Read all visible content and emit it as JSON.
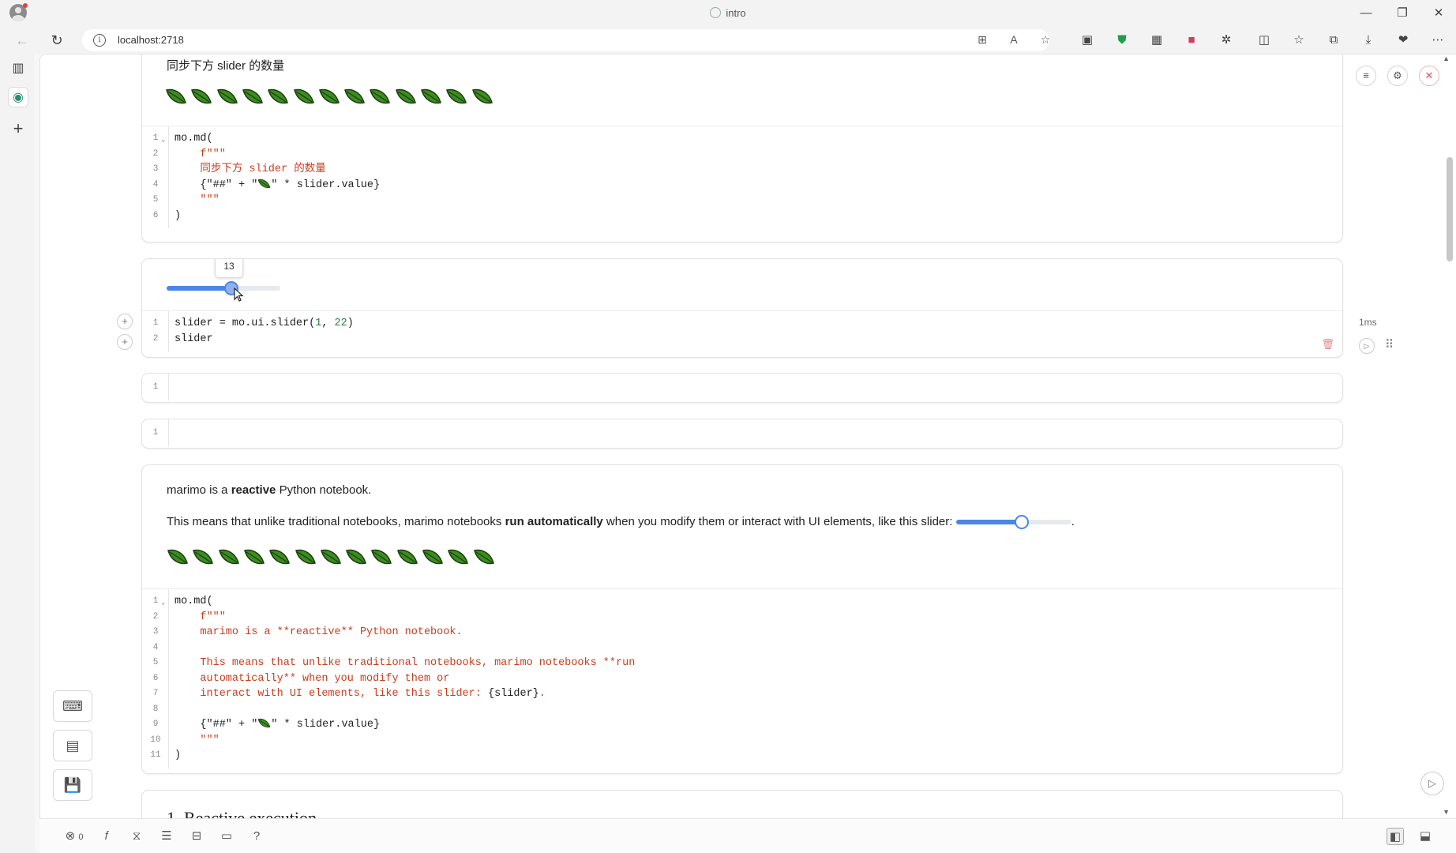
{
  "window": {
    "tab_title": "intro",
    "minimize": "—",
    "restore": "❐",
    "close": "✕"
  },
  "address_bar": {
    "url": "localhost:2718"
  },
  "cells": {
    "c1": {
      "output_text": "同步下方 slider 的数量",
      "leaf_count": 13,
      "code": [
        {
          "ln": "1",
          "fold": true,
          "parts": [
            [
              "mo.md(",
              ""
            ]
          ]
        },
        {
          "ln": "2",
          "parts": [
            [
              "    f\"\"\"",
              "s-str"
            ]
          ]
        },
        {
          "ln": "3",
          "parts": [
            [
              "    同步下方 slider 的数量",
              "s-str"
            ]
          ]
        },
        {
          "ln": "4",
          "parts": [
            [
              "    {\"##\" + \"",
              ""
            ],
            [
              "🍃",
              "leafglyph"
            ],
            [
              "\" * slider.value}",
              ""
            ]
          ]
        },
        {
          "ln": "5",
          "parts": [
            [
              "    \"\"\"",
              "s-str"
            ]
          ]
        },
        {
          "ln": "6",
          "parts": [
            [
              ")",
              ""
            ]
          ]
        }
      ]
    },
    "c2": {
      "slider_value": "13",
      "slider_fraction": 0.571,
      "run_time": "1ms",
      "code": [
        {
          "ln": "1",
          "parts": [
            [
              "slider = mo.ui.slider(",
              ""
            ],
            [
              "1",
              "s-num"
            ],
            [
              ", ",
              ""
            ],
            [
              "22",
              "s-num"
            ],
            [
              ")",
              ""
            ]
          ]
        },
        {
          "ln": "2",
          "parts": [
            [
              "slider",
              ""
            ]
          ]
        }
      ]
    },
    "c3": {
      "ln": "1"
    },
    "c4": {
      "ln": "1"
    },
    "c5": {
      "p1_pre": "marimo is a ",
      "p1_bold": "reactive",
      "p1_post": " Python notebook.",
      "p2_pre": "This means that unlike traditional notebooks, marimo notebooks ",
      "p2_bold": "run automatically",
      "p2_post": " when you modify them or interact with UI elements, like this slider: ",
      "p2_end": ".",
      "slider_fraction": 0.571,
      "leaf_count": 13,
      "code": [
        {
          "ln": "1",
          "fold": true,
          "parts": [
            [
              "mo.md(",
              ""
            ]
          ]
        },
        {
          "ln": "2",
          "parts": [
            [
              "    f\"\"\"",
              "s-str"
            ]
          ]
        },
        {
          "ln": "3",
          "parts": [
            [
              "    marimo is a **reactive** Python notebook.",
              "s-str"
            ]
          ]
        },
        {
          "ln": "4",
          "parts": [
            [
              "",
              ""
            ]
          ]
        },
        {
          "ln": "5",
          "parts": [
            [
              "    This means that unlike traditional notebooks, marimo notebooks **run",
              "s-str"
            ]
          ]
        },
        {
          "ln": "6",
          "parts": [
            [
              "    automatically** when you modify them or",
              "s-str"
            ]
          ]
        },
        {
          "ln": "7",
          "parts": [
            [
              "    interact with UI elements, like this slider: ",
              "s-str"
            ],
            [
              "{slider}",
              ""
            ],
            [
              ".",
              "s-str"
            ]
          ]
        },
        {
          "ln": "8",
          "parts": [
            [
              "",
              ""
            ]
          ]
        },
        {
          "ln": "9",
          "parts": [
            [
              "    {\"##\" + \"",
              ""
            ],
            [
              "🍃",
              "leafglyph"
            ],
            [
              "\" * slider.value}",
              ""
            ]
          ]
        },
        {
          "ln": "10",
          "parts": [
            [
              "    \"\"\"",
              "s-str"
            ]
          ]
        },
        {
          "ln": "11",
          "parts": [
            [
              ")",
              ""
            ]
          ]
        }
      ]
    },
    "c6": {
      "heading_partial": "1. Reactive execution"
    }
  },
  "footer": {
    "error_count": "0"
  },
  "colors": {
    "accent": "#4a86e8",
    "string": "#c83e1d",
    "number": "#2b7a44",
    "leaf_fill": "#3c8c1e",
    "leaf_edge": "#1a3d10"
  }
}
